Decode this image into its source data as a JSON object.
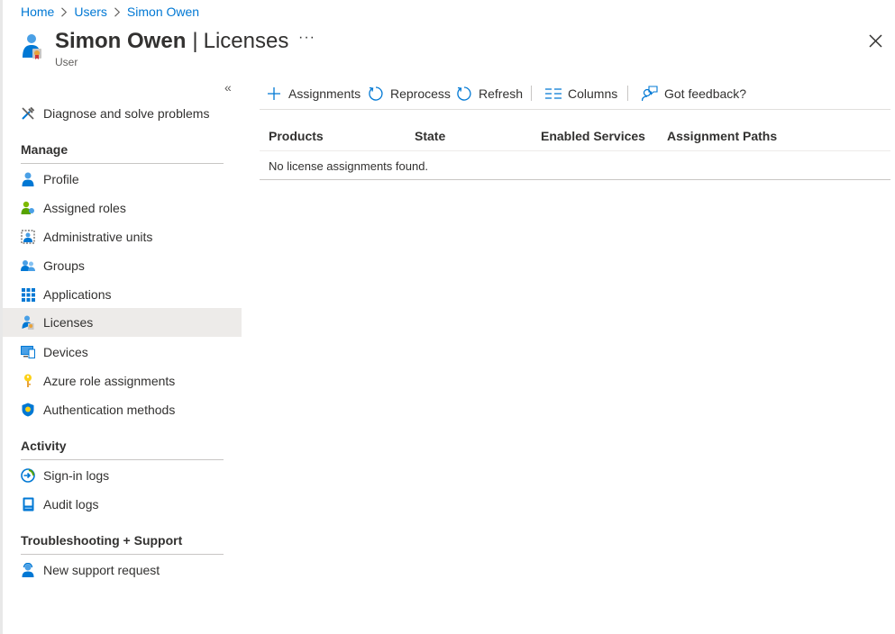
{
  "breadcrumb": {
    "items": [
      "Home",
      "Users",
      "Simon Owen"
    ]
  },
  "header": {
    "user_name": "Simon Owen",
    "separator": "|",
    "blade_title": "Licenses",
    "subtitle": "User",
    "more_label": "···",
    "icon": "user-license-icon",
    "close_icon": "close-icon"
  },
  "sidebar": {
    "collapse_label": "«",
    "top_item": {
      "label": "Diagnose and solve problems",
      "icon": "wrench-icon"
    },
    "sections": [
      {
        "title": "Manage",
        "items": [
          {
            "label": "Profile",
            "icon": "user-icon"
          },
          {
            "label": "Assigned roles",
            "icon": "user-role-icon"
          },
          {
            "label": "Administrative units",
            "icon": "admin-units-icon"
          },
          {
            "label": "Groups",
            "icon": "groups-icon"
          },
          {
            "label": "Applications",
            "icon": "grid-apps-icon"
          },
          {
            "label": "Licenses",
            "icon": "license-icon",
            "active": true
          },
          {
            "label": "Devices",
            "icon": "device-icon"
          },
          {
            "label": "Azure role assignments",
            "icon": "key-icon"
          },
          {
            "label": "Authentication methods",
            "icon": "shield-icon"
          }
        ]
      },
      {
        "title": "Activity",
        "items": [
          {
            "label": "Sign-in logs",
            "icon": "sign-in-icon"
          },
          {
            "label": "Audit logs",
            "icon": "audit-log-icon"
          }
        ]
      },
      {
        "title": "Troubleshooting + Support",
        "items": [
          {
            "label": "New support request",
            "icon": "support-icon"
          }
        ]
      }
    ]
  },
  "toolbar": {
    "assignments": {
      "label": "Assignments",
      "icon": "plus-icon"
    },
    "reprocess": {
      "label": "Reprocess",
      "icon": "reprocess-icon"
    },
    "refresh": {
      "label": "Refresh",
      "icon": "refresh-icon"
    },
    "columns": {
      "label": "Columns",
      "icon": "columns-icon"
    },
    "feedback": {
      "label": "Got feedback?",
      "icon": "feedback-icon"
    }
  },
  "grid": {
    "columns": [
      "Products",
      "State",
      "Enabled Services",
      "Assignment Paths"
    ],
    "empty_message": "No license assignments found."
  },
  "colors": {
    "accent": "#0078d4",
    "text": "#323130",
    "active_nav": "#edebe9"
  }
}
